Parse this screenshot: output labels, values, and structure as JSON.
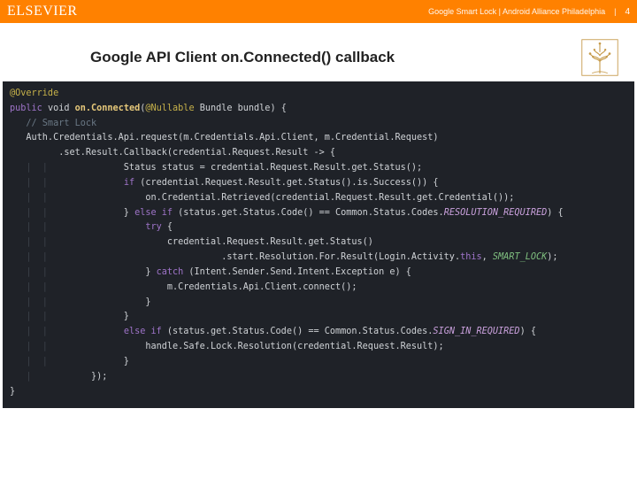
{
  "topbar": {
    "brand": "ELSEVIER",
    "meta": "Google Smart Lock | Android Alliance Philadelphia",
    "divider": "|",
    "pagenum": "4"
  },
  "header": {
    "title": "Google API Client on.Connected() callback"
  },
  "code": {
    "l01_override": "@Override",
    "l02_public": "public",
    "l02_void": " void ",
    "l02_fn": "on.Connected",
    "l02_paren_open": "(",
    "l02_nullable": "@Nullable",
    "l02_rest": " Bundle bundle) {",
    "l03_cmt": "   // Smart Lock",
    "l04": "   Auth.Credentials.Api.request(m.Credentials.Api.Client, m.Credential.Request)",
    "l05": "         .set.Result.Callback(credential.Request.Result -> {",
    "l06": "            Status status = credential.Request.Result.get.Status();",
    "l07a": "            ",
    "l07_if": "if",
    "l07b": " (credential.Request.Result.get.Status().is.Success()) {",
    "l08": "                on.Credential.Retrieved(credential.Request.Result.get.Credential());",
    "l09a": "            } ",
    "l09_else": "else if",
    "l09b": " (status.get.Status.Code() == Common.Status.Codes.",
    "l09_cls": "RESOLUTION_REQUIRED",
    "l09c": ") {",
    "l10a": "                ",
    "l10_try": "try",
    "l10b": " {",
    "l11": "                    credential.Request.Result.get.Status()",
    "l12a": "                              .start.Resolution.For.Result(Login.Activity.",
    "l12_this": "this",
    "l12b": ", ",
    "l12_const": "SMART_LOCK",
    "l12c": ");",
    "l13a": "                } ",
    "l13_catch": "catch",
    "l13b": " (Intent.Sender.Send.Intent.Exception e) {",
    "l14": "                    m.Credentials.Api.Client.connect();",
    "l15": "                }",
    "l16": "            }",
    "l17a": "            ",
    "l17_else": "else if",
    "l17b": " (status.get.Status.Code() == Common.Status.Codes.",
    "l17_cls": "SIGN_IN_REQUIRED",
    "l17c": ") {",
    "l18": "                handle.Safe.Lock.Resolution(credential.Request.Result);",
    "l19": "            }",
    "l20": "         });",
    "l21": "}"
  }
}
